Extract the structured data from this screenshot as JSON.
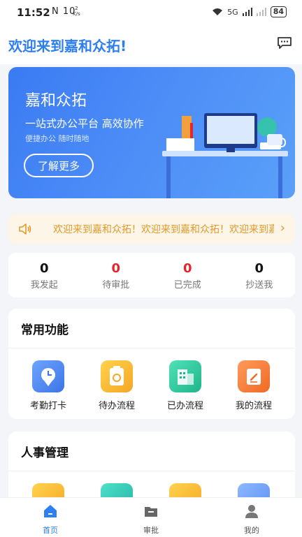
{
  "status_bar": {
    "time": "11:52",
    "left_icons": "N 10",
    "speed_top": "2",
    "speed_bottom": "K/s",
    "signal": "5G",
    "battery": "84"
  },
  "header": {
    "title": "欢迎来到嘉和众拓!"
  },
  "banner": {
    "title": "嘉和众拓",
    "subtitle": "一站式办公平台 高效协作",
    "tagline": "便捷办公 随时随地",
    "button_label": "了解更多"
  },
  "notice": {
    "text": "欢迎来到嘉和众拓！欢迎来到嘉和众拓！欢迎来到嘉和众拓！"
  },
  "stats": [
    {
      "value": "0",
      "label": "我发起"
    },
    {
      "value": "0",
      "label": "待审批"
    },
    {
      "value": "0",
      "label": "已完成"
    },
    {
      "value": "0",
      "label": "抄送我"
    }
  ],
  "common": {
    "title": "常用功能",
    "items": [
      {
        "label": "考勤打卡",
        "icon": "clock-location-icon"
      },
      {
        "label": "待办流程",
        "icon": "todo-clipboard-icon"
      },
      {
        "label": "已办流程",
        "icon": "building-icon"
      },
      {
        "label": "我的流程",
        "icon": "edit-note-icon"
      }
    ]
  },
  "hr": {
    "title": "人事管理"
  },
  "tabbar": [
    {
      "label": "首页",
      "icon": "home-icon"
    },
    {
      "label": "审批",
      "icon": "folder-icon"
    },
    {
      "label": "我的",
      "icon": "user-icon"
    }
  ],
  "colors": {
    "accent": "#2b7ff0",
    "stat_red": "#e3262c",
    "notice_text": "#e09a2a"
  }
}
